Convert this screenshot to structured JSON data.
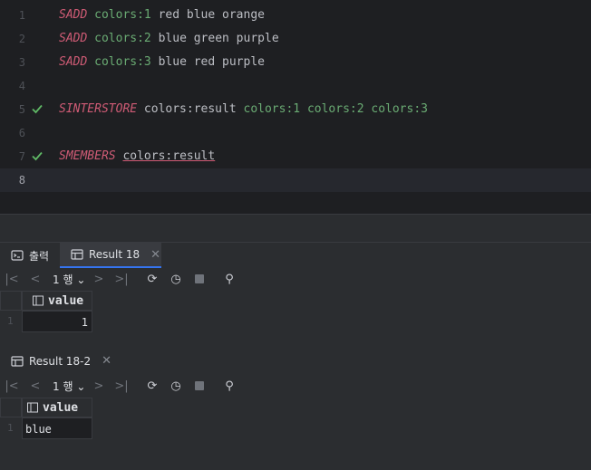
{
  "editor": {
    "lines": [
      {
        "num": "1",
        "tokens": [
          {
            "t": "SADD",
            "c": "kw"
          },
          {
            "t": " "
          },
          {
            "t": "colors:1",
            "c": "key"
          },
          {
            "t": " red blue orange"
          }
        ]
      },
      {
        "num": "2",
        "tokens": [
          {
            "t": "SADD",
            "c": "kw"
          },
          {
            "t": " "
          },
          {
            "t": "colors:2",
            "c": "key"
          },
          {
            "t": " blue green purple"
          }
        ]
      },
      {
        "num": "3",
        "tokens": [
          {
            "t": "SADD",
            "c": "kw"
          },
          {
            "t": " "
          },
          {
            "t": "colors:3",
            "c": "key"
          },
          {
            "t": " blue red purple"
          }
        ]
      },
      {
        "num": "4",
        "tokens": []
      },
      {
        "num": "5",
        "check": true,
        "tokens": [
          {
            "t": "SINTERSTORE",
            "c": "kw"
          },
          {
            "t": " colors:result "
          },
          {
            "t": "colors:1 colors:2 colors:3",
            "c": "key"
          }
        ]
      },
      {
        "num": "6",
        "tokens": []
      },
      {
        "num": "7",
        "check": true,
        "tokens": [
          {
            "t": "SMEMBERS",
            "c": "kw"
          },
          {
            "t": " "
          },
          {
            "t": "colors:result",
            "c": "ul"
          }
        ]
      },
      {
        "num": "8",
        "current": true,
        "tokens": []
      }
    ]
  },
  "tabs": {
    "output_label": "출력",
    "result_label": "Result 18"
  },
  "result1": {
    "rows_label": "1 행",
    "column": "value",
    "row_num": "1",
    "value": "1"
  },
  "result2": {
    "title": "Result 18-2",
    "rows_label": "1 행",
    "column": "value",
    "row_num": "1",
    "value": "blue"
  },
  "colors": {
    "check": "#5fb865",
    "keyword": "#cf5b75",
    "key": "#6aab73",
    "accent": "#3574f0"
  }
}
